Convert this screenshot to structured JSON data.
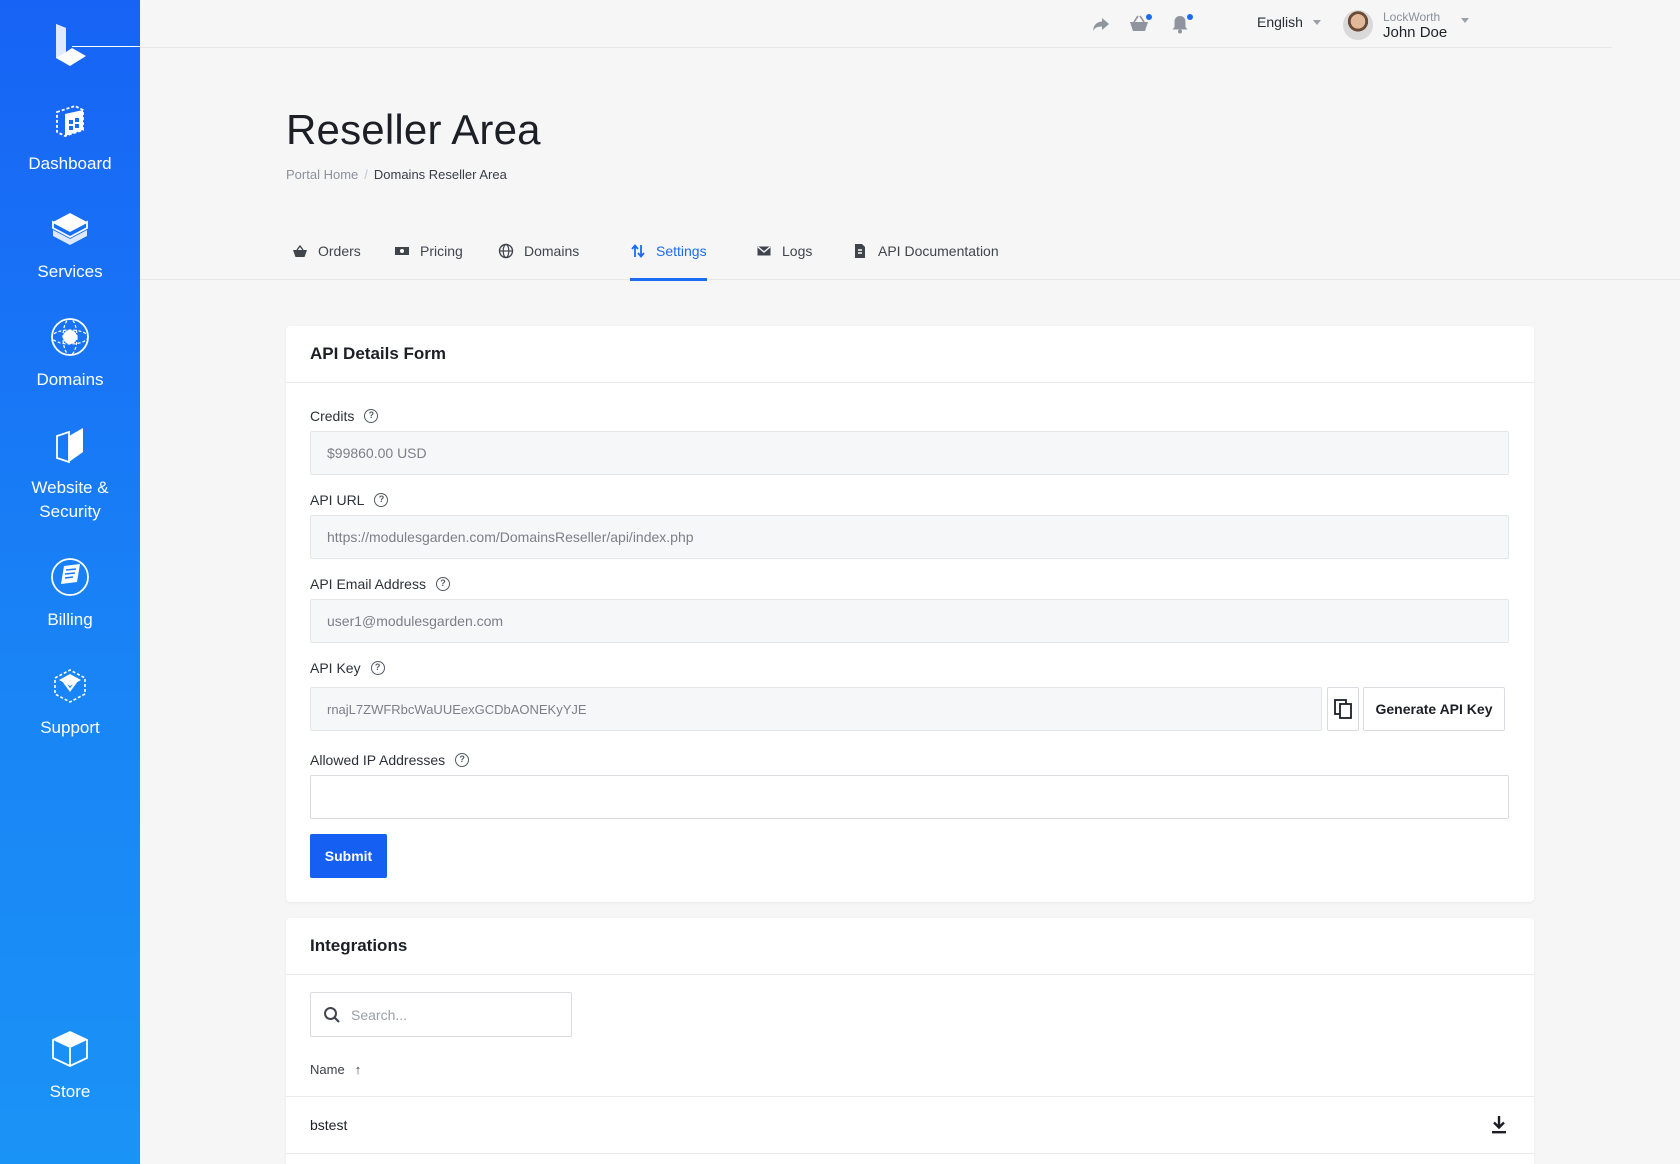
{
  "sidebar": {
    "items": [
      {
        "label": "Dashboard"
      },
      {
        "label": "Services"
      },
      {
        "label": "Domains"
      },
      {
        "label_line1": "Website &",
        "label_line2": "Security"
      },
      {
        "label": "Billing"
      },
      {
        "label": "Support"
      },
      {
        "label": "Store"
      }
    ]
  },
  "topbar": {
    "icons": [
      "share-icon",
      "basket-icon",
      "bell-icon"
    ],
    "language": "English",
    "user": {
      "company": "LockWorth",
      "name": "John Doe"
    }
  },
  "page": {
    "title": "Reseller Area",
    "breadcrumb": {
      "home": "Portal Home",
      "separator": "/",
      "current": "Domains Reseller Area"
    }
  },
  "tabs": [
    {
      "label": "Orders",
      "icon": "basket-icon"
    },
    {
      "label": "Pricing",
      "icon": "money-icon"
    },
    {
      "label": "Domains",
      "icon": "globe-icon"
    },
    {
      "label": "Settings",
      "icon": "sort-arrows-icon",
      "active": true
    },
    {
      "label": "Logs",
      "icon": "envelope-icon"
    },
    {
      "label": "API Documentation",
      "icon": "document-icon"
    }
  ],
  "api_form": {
    "title": "API Details Form",
    "credits": {
      "label": "Credits",
      "value": "$99860.00 USD"
    },
    "api_url": {
      "label": "API URL",
      "value": "https://modulesgarden.com/DomainsReseller/api/index.php"
    },
    "api_email": {
      "label": "API Email Address",
      "value": "user1@modulesgarden.com"
    },
    "api_key": {
      "label": "API Key",
      "value": "rnajL7ZWFRbcWaUUEexGCDbAONEKyYJE",
      "generate_label": "Generate API Key"
    },
    "allowed_ips": {
      "label": "Allowed IP Addresses",
      "value": ""
    },
    "help_glyph": "?",
    "submit_label": "Submit"
  },
  "integrations": {
    "title": "Integrations",
    "search_placeholder": "Search...",
    "column_name": "Name",
    "sort_glyph": "↑",
    "rows": [
      {
        "name": "bstest"
      }
    ]
  },
  "colors": {
    "accent": "#1b6cf2",
    "sidebar_top": "#1763f5",
    "sidebar_bottom": "#1a93f6"
  }
}
